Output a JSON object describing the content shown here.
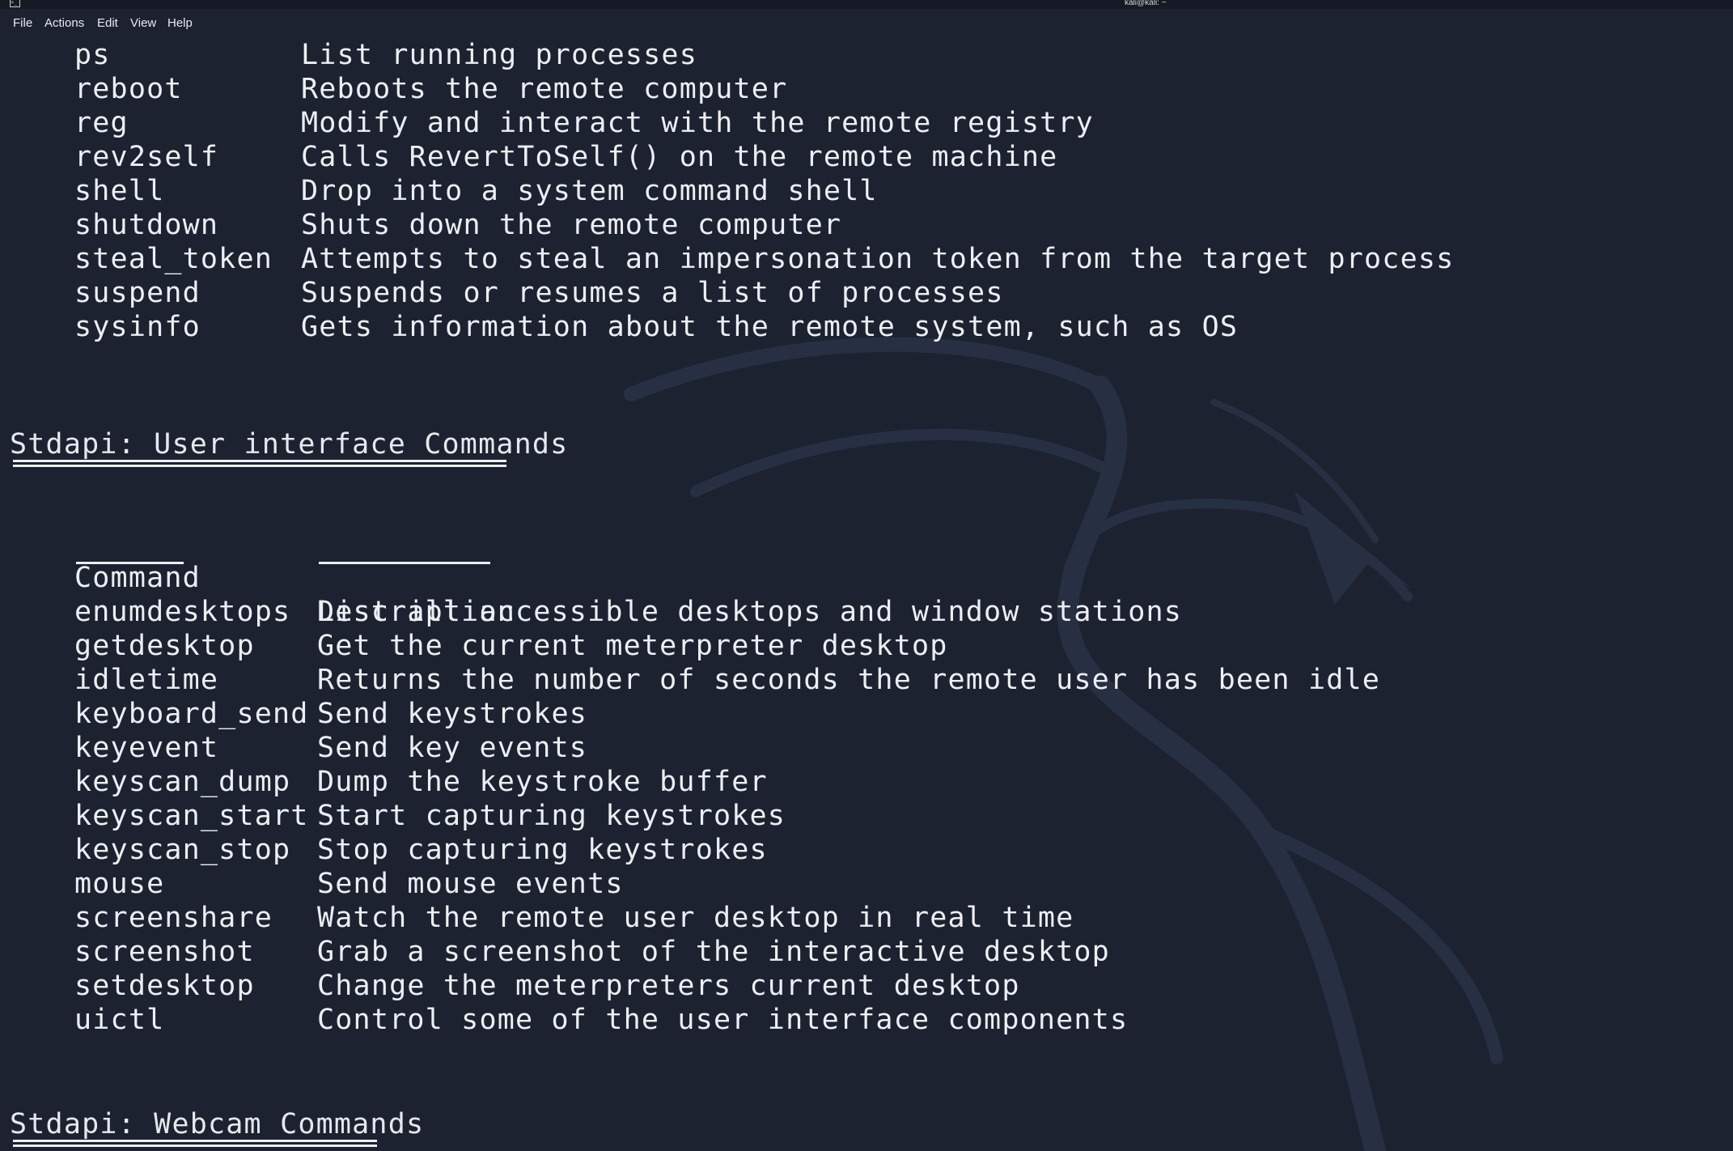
{
  "window": {
    "title": "kali@kali: ~",
    "terminal_icon": "terminal-icon"
  },
  "menu": [
    "File",
    "Actions",
    "Edit",
    "View",
    "Help"
  ],
  "colors": {
    "background": "#1c2230",
    "foreground": "#eceef2",
    "watermark": "#2a3142"
  },
  "core_commands_tail": [
    {
      "command": "ps",
      "description": "List running processes"
    },
    {
      "command": "reboot",
      "description": "Reboots the remote computer"
    },
    {
      "command": "reg",
      "description": "Modify and interact with the remote registry"
    },
    {
      "command": "rev2self",
      "description": "Calls RevertToSelf() on the remote machine"
    },
    {
      "command": "shell",
      "description": "Drop into a system command shell"
    },
    {
      "command": "shutdown",
      "description": "Shuts down the remote computer"
    },
    {
      "command": "steal_token",
      "description": "Attempts to steal an impersonation token from the target process"
    },
    {
      "command": "suspend",
      "description": "Suspends or resumes a list of processes"
    },
    {
      "command": "sysinfo",
      "description": "Gets information about the remote system, such as OS"
    }
  ],
  "ui_section": {
    "title": "Stdapi: User interface Commands",
    "col_command": "Command",
    "col_description": "Description",
    "rows": [
      {
        "command": "enumdesktops",
        "description": "List all accessible desktops and window stations"
      },
      {
        "command": "getdesktop",
        "description": "Get the current meterpreter desktop"
      },
      {
        "command": "idletime",
        "description": "Returns the number of seconds the remote user has been idle"
      },
      {
        "command": "keyboard_send",
        "description": "Send keystrokes"
      },
      {
        "command": "keyevent",
        "description": "Send key events"
      },
      {
        "command": "keyscan_dump",
        "description": "Dump the keystroke buffer"
      },
      {
        "command": "keyscan_start",
        "description": "Start capturing keystrokes"
      },
      {
        "command": "keyscan_stop",
        "description": "Stop capturing keystrokes"
      },
      {
        "command": "mouse",
        "description": "Send mouse events"
      },
      {
        "command": "screenshare",
        "description": "Watch the remote user desktop in real time"
      },
      {
        "command": "screenshot",
        "description": "Grab a screenshot of the interactive desktop"
      },
      {
        "command": "setdesktop",
        "description": "Change the meterpreters current desktop"
      },
      {
        "command": "uictl",
        "description": "Control some of the user interface components"
      }
    ]
  },
  "webcam_section": {
    "title": "Stdapi: Webcam Commands"
  }
}
